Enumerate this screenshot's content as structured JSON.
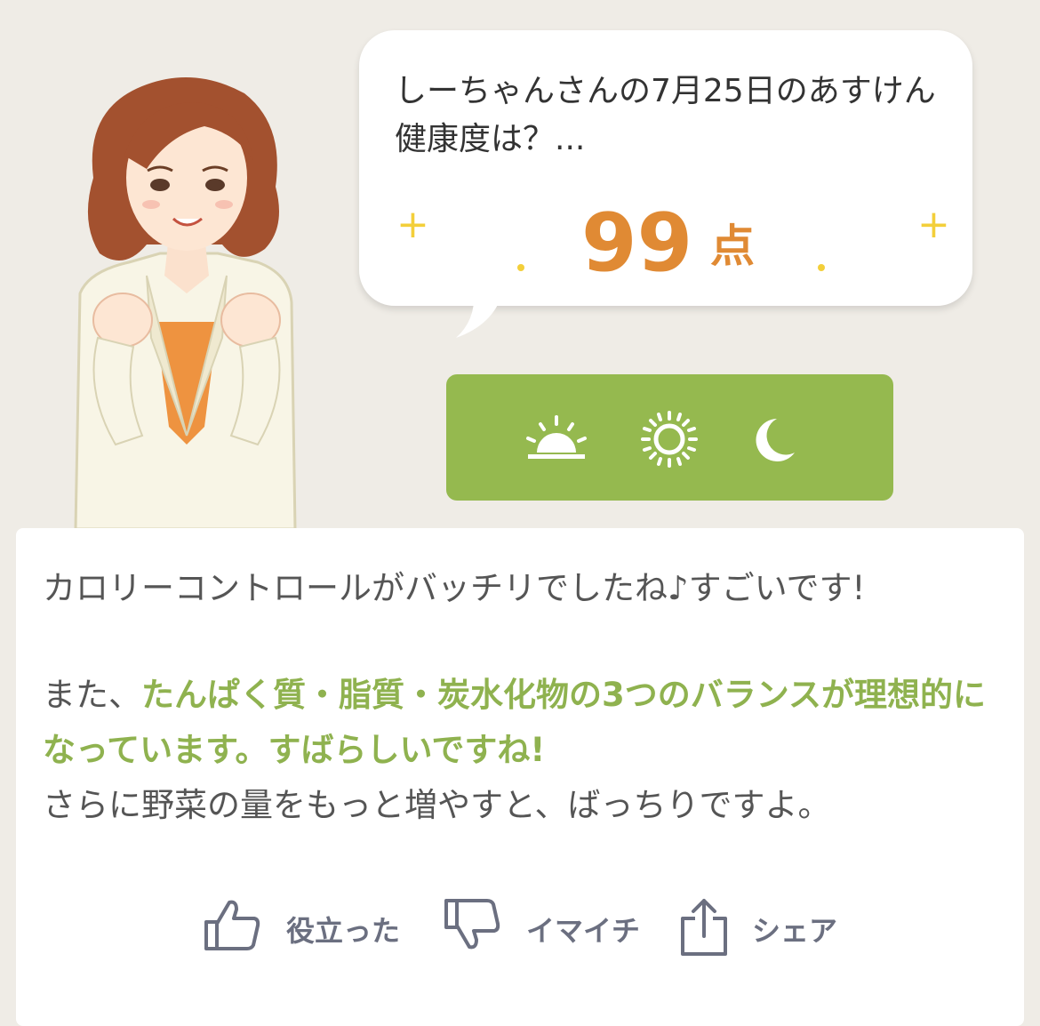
{
  "bubble": {
    "question": "しーちゃんさんの7月25日のあすけん健康度は？...",
    "score": "99",
    "score_unit": "点"
  },
  "time_of_day": {
    "icons": [
      "sunrise-icon",
      "sun-icon",
      "moon-icon"
    ]
  },
  "message": {
    "line1": "カロリーコントロールがバッチリでしたね♪すごいです!",
    "line2_prefix": "また、",
    "line2_highlight": "たんぱく質・脂質・炭水化物の3つのバランスが理想的になっています。すばらしいですね!",
    "line3": "さらに野菜の量をもっと増やすと、ばっちりですよ。"
  },
  "actions": {
    "helpful_label": "役立った",
    "not_helpful_label": "イマイチ",
    "share_label": "シェア"
  },
  "colors": {
    "background": "#efece6",
    "score": "#e08a34",
    "accent_green": "#95b94f",
    "highlight_text": "#8fb24f",
    "sparkle": "#f3cf3a"
  }
}
